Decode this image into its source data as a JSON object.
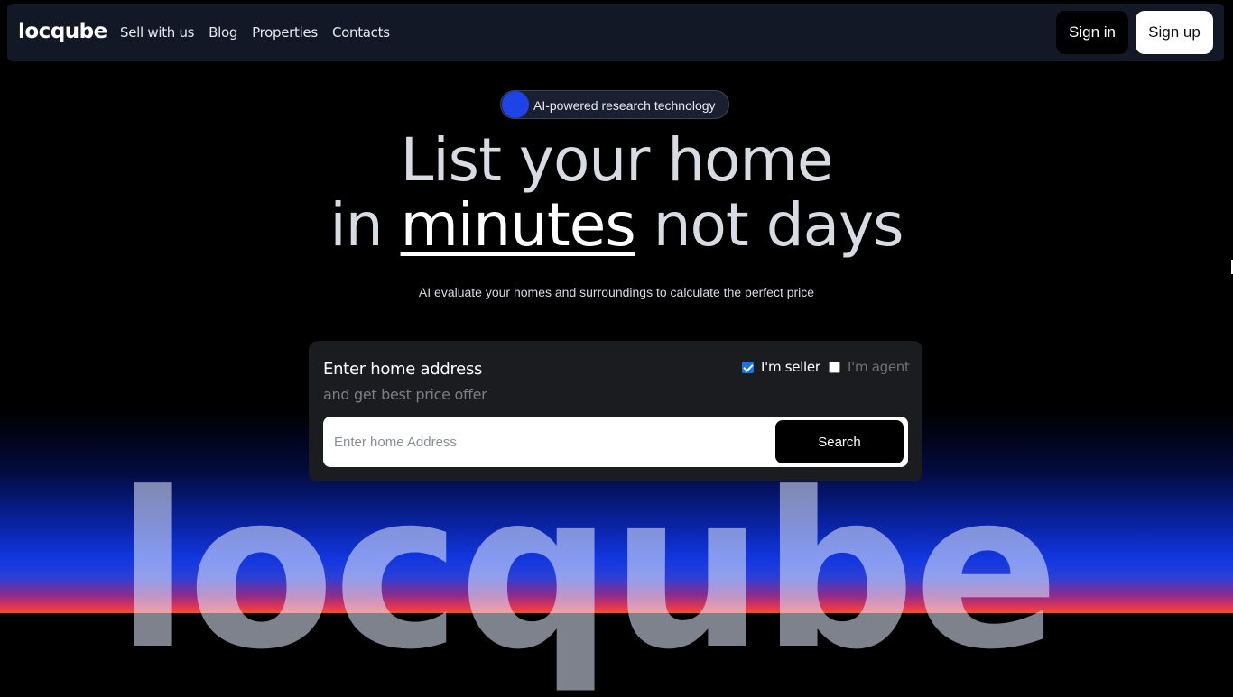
{
  "nav": {
    "brand": "locqube",
    "links": [
      "Sell with us",
      "Blog",
      "Properties",
      "Contacts"
    ],
    "signin_label": "Sign in",
    "signup_label": "Sign up"
  },
  "hero": {
    "badge_text": "AI-powered research technology",
    "headline_line1": "List your home",
    "headline_in": "in",
    "headline_emphasis": "minutes",
    "headline_rest": "not days",
    "subtitle": "AI evaluate your homes and surroundings to calculate the perfect price"
  },
  "search_card": {
    "title": "Enter home address",
    "subtitle": "and get best price offer",
    "seller_label": "I'm seller",
    "seller_checked": true,
    "agent_label": "I'm agent",
    "agent_checked": false,
    "input_placeholder": "Enter home Address",
    "input_value": "",
    "search_label": "Search"
  },
  "background_text": "locqube",
  "colors": {
    "accent_blue": "#1e43e6",
    "nav_bg": "#121826",
    "card_bg": "#1b1c20"
  }
}
